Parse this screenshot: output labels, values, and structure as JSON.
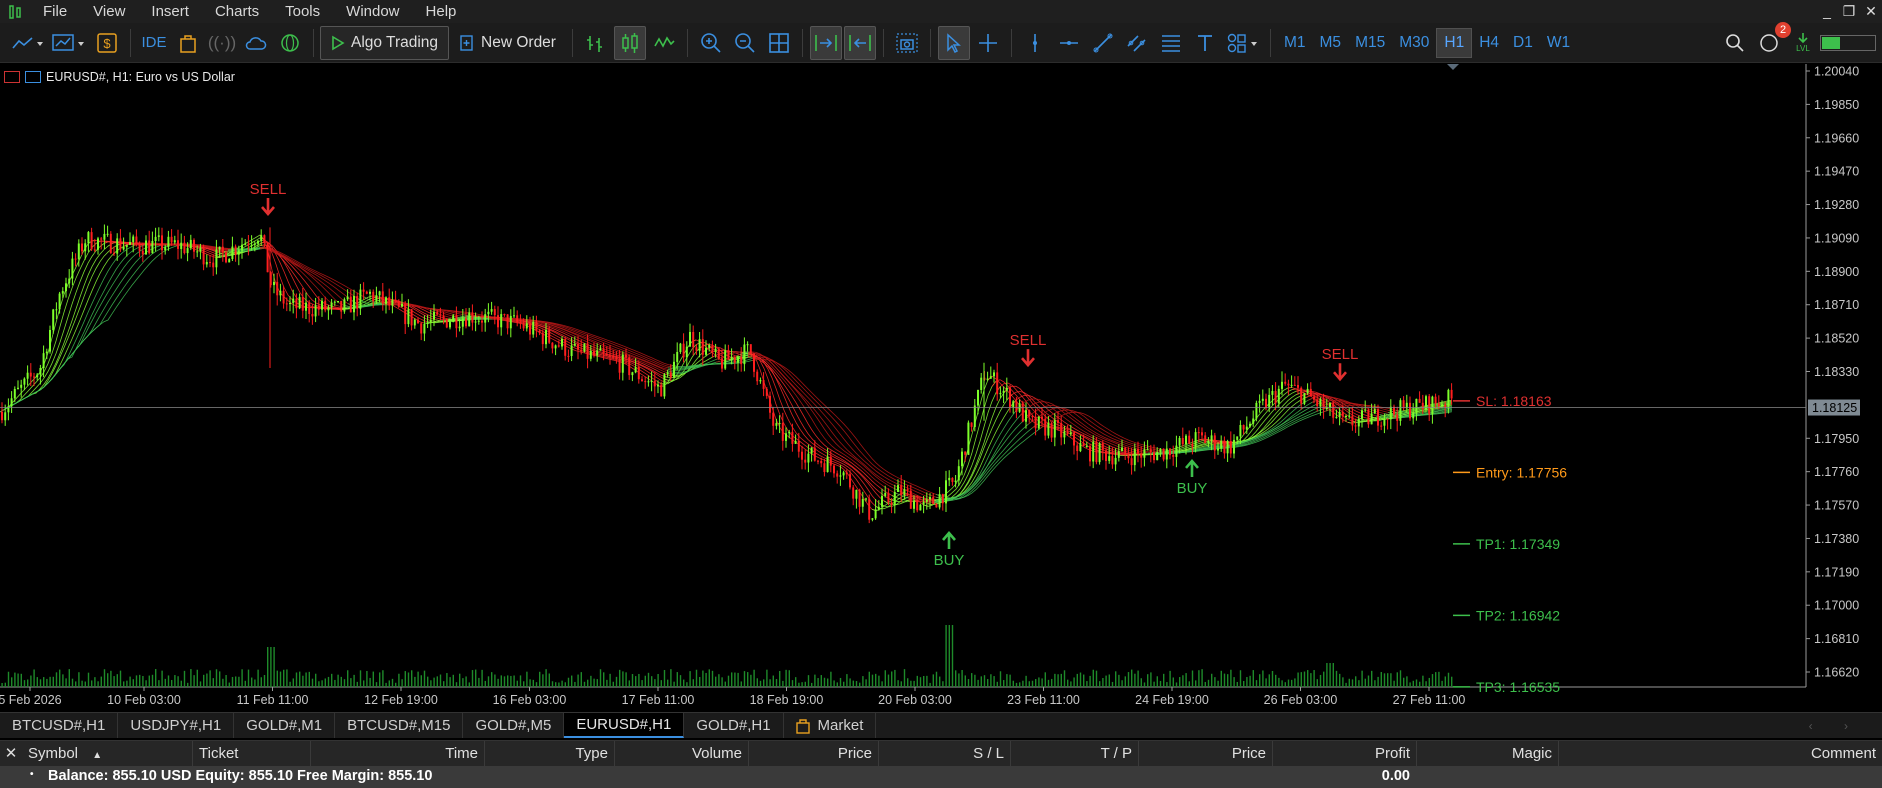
{
  "menu": {
    "items": [
      "File",
      "View",
      "Insert",
      "Charts",
      "Tools",
      "Window",
      "Help"
    ]
  },
  "toolbar": {
    "algo_trading": "Algo Trading",
    "new_order": "New Order",
    "ide": "IDE",
    "timeframes": [
      "M1",
      "M5",
      "M15",
      "M30",
      "H1",
      "H4",
      "D1",
      "W1"
    ],
    "active_timeframe": "H1",
    "notifications_count": "2",
    "lvl_label": "LVL"
  },
  "chart": {
    "title": "EURUSD#, H1:  Euro vs US Dollar",
    "current_price": "1.18125",
    "price_ticks": [
      "1.20040",
      "1.19850",
      "1.19660",
      "1.19470",
      "1.19280",
      "1.19090",
      "1.18900",
      "1.18710",
      "1.18520",
      "1.18330",
      "1.17950",
      "1.17760",
      "1.17570",
      "1.17380",
      "1.17190",
      "1.17000",
      "1.16810",
      "1.16620"
    ],
    "time_ticks": [
      "5 Feb 2026",
      "10 Feb 03:00",
      "11 Feb 11:00",
      "12 Feb 19:00",
      "16 Feb 03:00",
      "17 Feb 11:00",
      "18 Feb 19:00",
      "20 Feb 03:00",
      "23 Feb 11:00",
      "24 Feb 19:00",
      "26 Feb 03:00",
      "27 Feb 11:00"
    ],
    "signals": [
      {
        "label": "SELL",
        "type": "sell"
      },
      {
        "label": "SELL",
        "type": "sell"
      },
      {
        "label": "SELL",
        "type": "sell"
      },
      {
        "label": "BUY",
        "type": "buy"
      },
      {
        "label": "BUY",
        "type": "buy"
      }
    ],
    "levels": {
      "sl": "SL: 1.18163",
      "entry": "Entry: 1.17756",
      "tp1": "TP1: 1.17349",
      "tp2": "TP2: 1.16942",
      "tp3": "TP3: 1.16535"
    },
    "colors": {
      "bull": "#7dff2a",
      "bear": "#ff1e1e",
      "entry": "#ff9a1a",
      "tp": "#3dbf4c",
      "sl": "#e03030",
      "axis_text": "#c8c8c8"
    }
  },
  "symbol_tabs": [
    "BTCUSD#,H1",
    "USDJPY#,H1",
    "GOLD#,M1",
    "BTCUSD#,M15",
    "GOLD#,M5",
    "EURUSD#,H1",
    "GOLD#,H1",
    "Market"
  ],
  "active_symbol_tab": "EURUSD#,H1",
  "terminal": {
    "columns": [
      "Symbol",
      "Ticket",
      "Time",
      "Type",
      "Volume",
      "Price",
      "S / L",
      "T / P",
      "Price",
      "Profit",
      "Magic",
      "Comment"
    ],
    "balance_line": "Balance: 855.10 USD  Equity: 855.10  Free Margin: 855.10",
    "profit_total": "0.00"
  }
}
